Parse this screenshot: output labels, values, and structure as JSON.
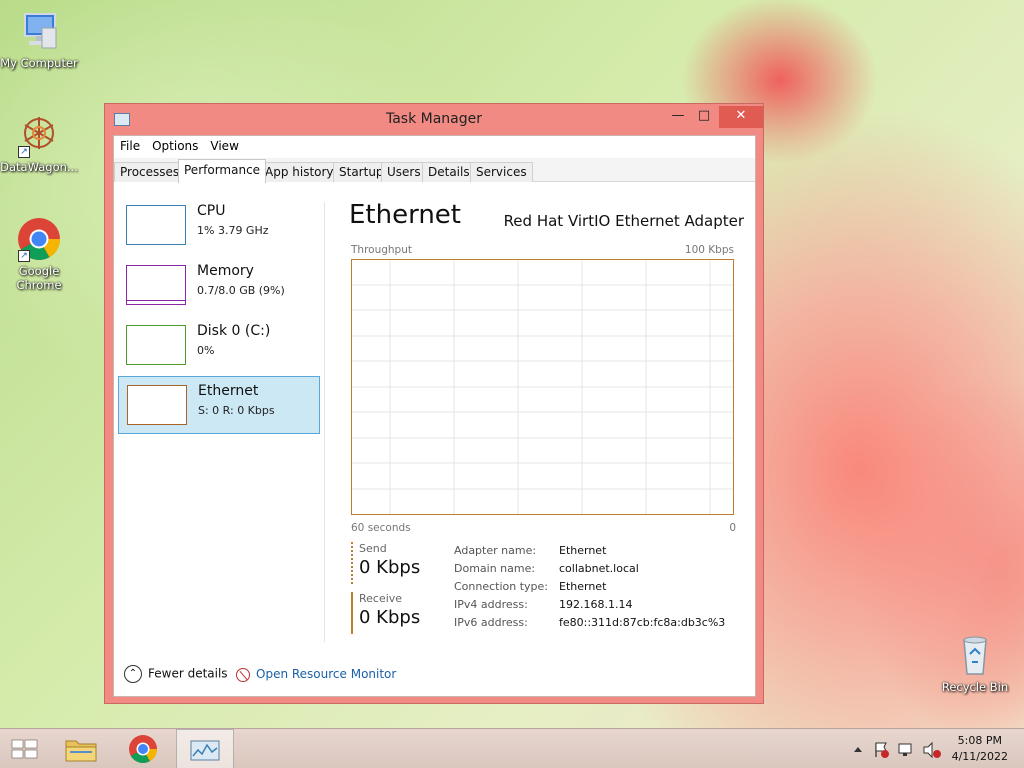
{
  "desktop": {
    "icons": [
      {
        "label": "My Computer"
      },
      {
        "label": "DataWagon..."
      },
      {
        "label": "Google Chrome"
      },
      {
        "label": "Recycle Bin"
      }
    ]
  },
  "window": {
    "title": "Task Manager",
    "menu": [
      "File",
      "Options",
      "View"
    ],
    "tabs": [
      "Processes",
      "Performance",
      "App history",
      "Startup",
      "Users",
      "Details",
      "Services"
    ],
    "active_tab": "Performance",
    "perf_items": [
      {
        "name": "CPU",
        "value": "1%  3.79 GHz",
        "color": "#3c7fb1"
      },
      {
        "name": "Memory",
        "value": "0.7/8.0 GB (9%)",
        "color": "#8b28a8"
      },
      {
        "name": "Disk 0 (C:)",
        "value": "0%",
        "color": "#4d9a2a"
      },
      {
        "name": "Ethernet",
        "value": "S: 0 R: 0 Kbps",
        "color": "#a7652a"
      }
    ],
    "detail": {
      "title": "Ethernet",
      "adapter": "Red Hat VirtIO Ethernet Adapter",
      "graph_label": "Throughput",
      "graph_max": "100 Kbps",
      "time_label": "60 seconds",
      "zero_label": "0",
      "send_label": "Send",
      "send_value": "0 Kbps",
      "receive_label": "Receive",
      "receive_value": "0 Kbps",
      "properties": [
        {
          "key": "Adapter name:",
          "value": "Ethernet"
        },
        {
          "key": "Domain name:",
          "value": "collabnet.local"
        },
        {
          "key": "Connection type:",
          "value": "Ethernet"
        },
        {
          "key": "IPv4 address:",
          "value": "192.168.1.14"
        },
        {
          "key": "IPv6 address:",
          "value": "fe80::311d:87cb:fc8a:db3c%3"
        }
      ]
    },
    "footer": {
      "fewer_details": "Fewer details",
      "resource_monitor": "Open Resource Monitor"
    }
  },
  "taskbar": {
    "time": "5:08 PM",
    "date": "4/11/2022"
  }
}
